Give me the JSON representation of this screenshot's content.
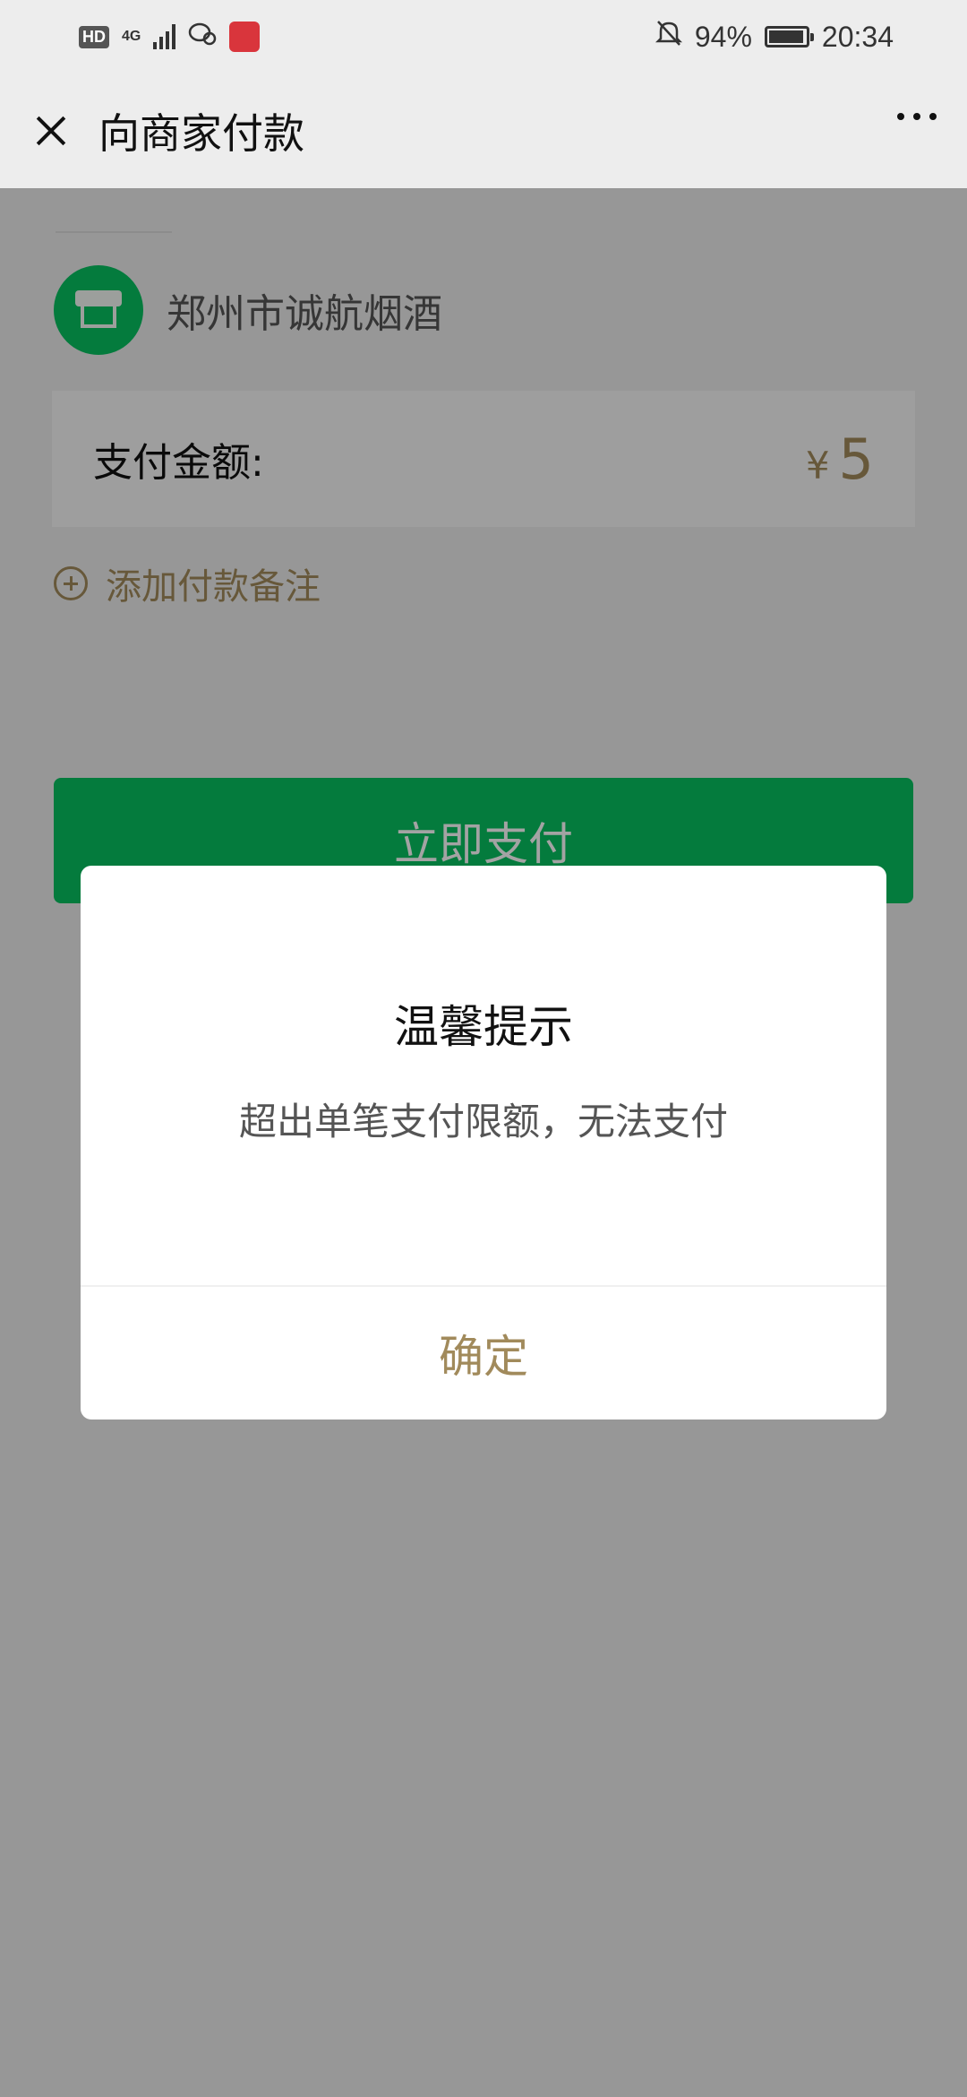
{
  "status_bar": {
    "hd_badge": "HD",
    "network": "4G",
    "battery_percent": "94%",
    "battery_level": 0.94,
    "time": "20:34"
  },
  "nav": {
    "title": "向商家付款",
    "close_icon": "close-icon",
    "more_icon": "more-icon"
  },
  "merchant": {
    "name": "郑州市诚航烟酒",
    "avatar_icon": "store-icon",
    "avatar_color": "#07c160"
  },
  "amount": {
    "label": "支付金额:",
    "currency_symbol": "¥",
    "value": "5"
  },
  "remark": {
    "label": "添加付款备注",
    "icon": "plus-circle-icon"
  },
  "pay_button": {
    "label": "立即支付",
    "color": "#07c160"
  },
  "dialog": {
    "title": "温馨提示",
    "message": "超出单笔支付限额，无法支付",
    "confirm_label": "确定",
    "accent_color": "#a18a5b"
  }
}
